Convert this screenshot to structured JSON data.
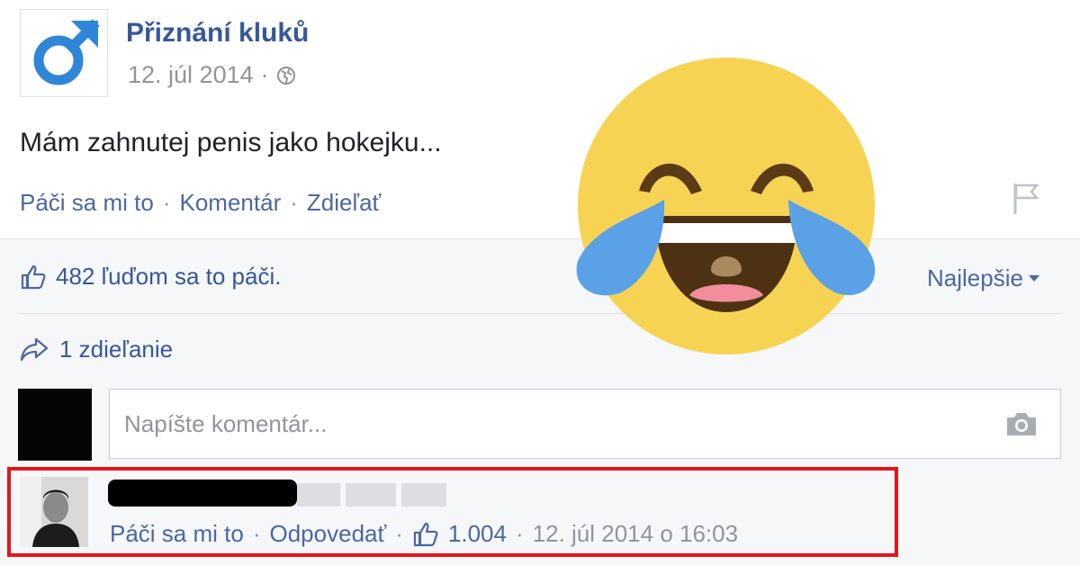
{
  "post": {
    "page_name": "Přiznání kluků",
    "date": "12. júl 2014",
    "meta_separator": "·",
    "text": "Mám zahnutej penis jako hokejku...",
    "actions": {
      "like": "Páči sa mi to",
      "comment": "Komentár",
      "share": "Zdieľať",
      "separator": "·"
    }
  },
  "stats": {
    "likes_text": "482 ľuďom sa to páči.",
    "sort_label": "Najlepšie",
    "shares_text": "1 zdieľanie"
  },
  "composer": {
    "placeholder": "Napíšte komentár..."
  },
  "comment": {
    "like": "Páči sa mi to",
    "reply": "Odpovedať",
    "like_count": "1.004",
    "timestamp": "12. júl 2014 o 16:03",
    "separator": "·"
  },
  "colors": {
    "link_blue": "#4b67a1",
    "page_name_blue": "#365899",
    "meta_grey": "#90949c",
    "highlight_red": "#e3151a",
    "emoji_yellow": "#f7d354",
    "tear_blue": "#5aa1e6"
  },
  "icons": [
    "male-symbol-icon",
    "globe-icon",
    "flag-icon",
    "like-thumb-icon",
    "share-arrow-icon",
    "camera-icon",
    "caret-down-icon",
    "laughing-crying-emoji"
  ]
}
